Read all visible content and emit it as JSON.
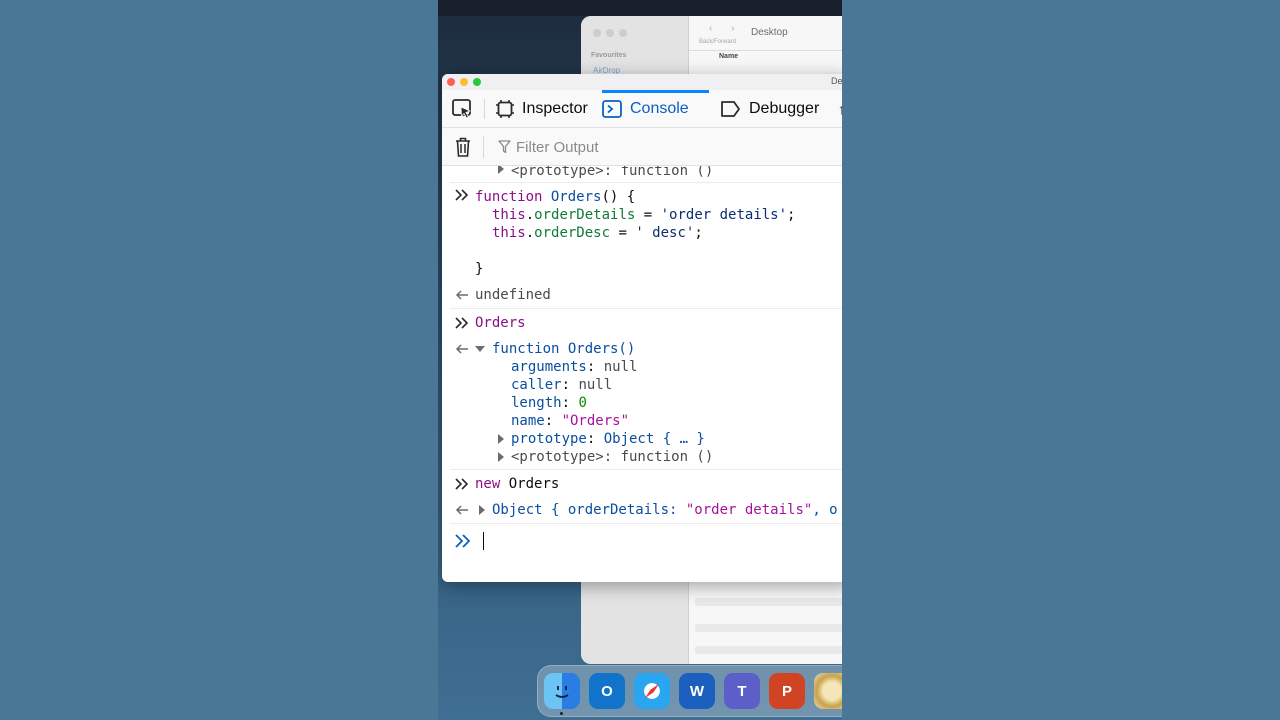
{
  "finder": {
    "title": "Desktop",
    "back_forward_label": "Back/Forward",
    "favourites_label": "Favourites",
    "airdrop_label": "AirDrop",
    "name_column": "Name"
  },
  "devtools": {
    "window_title": "De",
    "tabs": [
      {
        "label": "Inspector"
      },
      {
        "label": "Console",
        "active": true
      },
      {
        "label": "Debugger"
      }
    ],
    "filter_placeholder": "Filter Output"
  },
  "console": {
    "lines": {
      "proto_top": "<prototype>: function ()",
      "in1_l1_kw": "function",
      "in1_l1_name": "Orders",
      "in1_l1_rest": "() {",
      "in1_l2_this": "this",
      "in1_l2_dot": ".",
      "in1_l2_prop": "orderDetails",
      "in1_l2_eq": " = ",
      "in1_l2_str": "'order details'",
      "in1_l2_end": ";",
      "in1_l3_this": "this",
      "in1_l3_dot": ".",
      "in1_l3_prop": "orderDesc",
      "in1_l3_eq": " = ",
      "in1_l3_str": "' desc'",
      "in1_l3_end": ";",
      "in1_l5": "}",
      "out1": "undefined",
      "in2": "Orders",
      "out2_head": "function Orders()",
      "out2_args_key": "arguments",
      "out2_args_val": "null",
      "out2_caller_key": "caller",
      "out2_caller_val": "null",
      "out2_length_key": "length",
      "out2_length_val": "0",
      "out2_name_key": "name",
      "out2_name_val": "\"Orders\"",
      "out2_proto_key": "prototype",
      "out2_proto_val": "Object { … }",
      "out2_proto2": "<prototype>: function ()",
      "in3_kw": "new",
      "in3_rest": " Orders",
      "out3_head": "Object { orderDetails: ",
      "out3_str": "\"order details\"",
      "out3_tail": ", o"
    },
    "colon": ": "
  },
  "dock": {
    "apps": [
      "finder-icon",
      "outlook-icon",
      "safari-icon",
      "word-icon",
      "teams-icon",
      "powerpoint-icon",
      "photos-icon"
    ],
    "letters": {
      "outlook": "O",
      "word": "W",
      "teams": "T",
      "powerpoint": "P"
    }
  }
}
